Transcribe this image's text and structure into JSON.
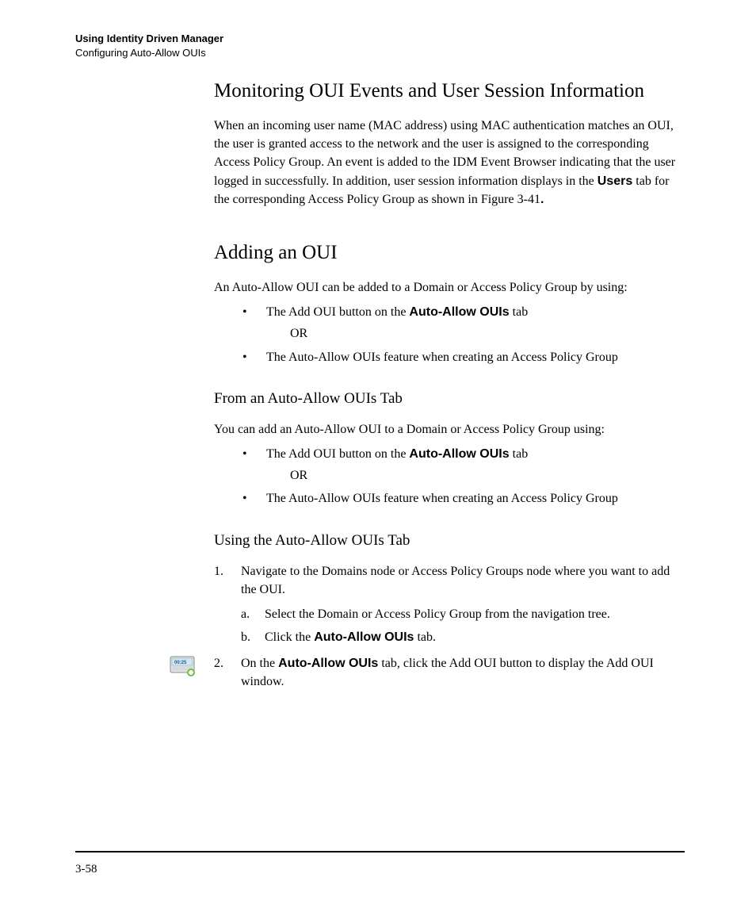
{
  "header": {
    "line1": "Using Identity Driven Manager",
    "line2": "Configuring Auto-Allow OUIs"
  },
  "section1": {
    "title": "Monitoring OUI Events and User Session Information",
    "para_pre": "When an incoming user name (MAC address) using MAC authentication matches an OUI, the user is granted access to the network and the user is assigned to the corresponding Access Policy Group. An event is added to the IDM Event Browser indicating that the user logged in successfully. In addition, user session information displays in the ",
    "para_bold": "Users",
    "para_post": " tab for the corresponding Access Policy Group as shown in Figure 3-41",
    "para_end": "."
  },
  "section2": {
    "title": "Adding an OUI",
    "intro": "An Auto-Allow OUI can be added to a Domain or Access Policy Group by using:",
    "bullet1_pre": "The Add OUI button on the ",
    "bullet1_bold": "Auto-Allow OUIs",
    "bullet1_post": " tab",
    "or": "OR",
    "bullet2": "The Auto-Allow OUIs feature when creating an Access Policy Group"
  },
  "sub1": {
    "title": "From an Auto-Allow OUIs Tab",
    "intro": "You can add an Auto-Allow OUI to a Domain or Access Policy Group using:",
    "bullet1_pre": "The Add OUI button on the ",
    "bullet1_bold": "Auto-Allow OUIs",
    "bullet1_post": " tab",
    "or": "OR",
    "bullet2": "The Auto-Allow OUIs feature when creating an Access Policy Group"
  },
  "sub2": {
    "title": "Using the Auto-Allow OUIs Tab",
    "step1": "Navigate to the Domains node or Access Policy Groups node where you want to add the OUI.",
    "step1a_marker": "a.",
    "step1a": "Select the Domain or Access Policy Group from the navigation tree.",
    "step1b_marker": "b.",
    "step1b_pre": "Click the ",
    "step1b_bold": "Auto-Allow OUIs",
    "step1b_post": " tab.",
    "step2_pre": "On the ",
    "step2_bold": "Auto-Allow OUIs",
    "step2_post": " tab, click the Add OUI button to display the Add OUI window."
  },
  "pageNumber": "3-58"
}
